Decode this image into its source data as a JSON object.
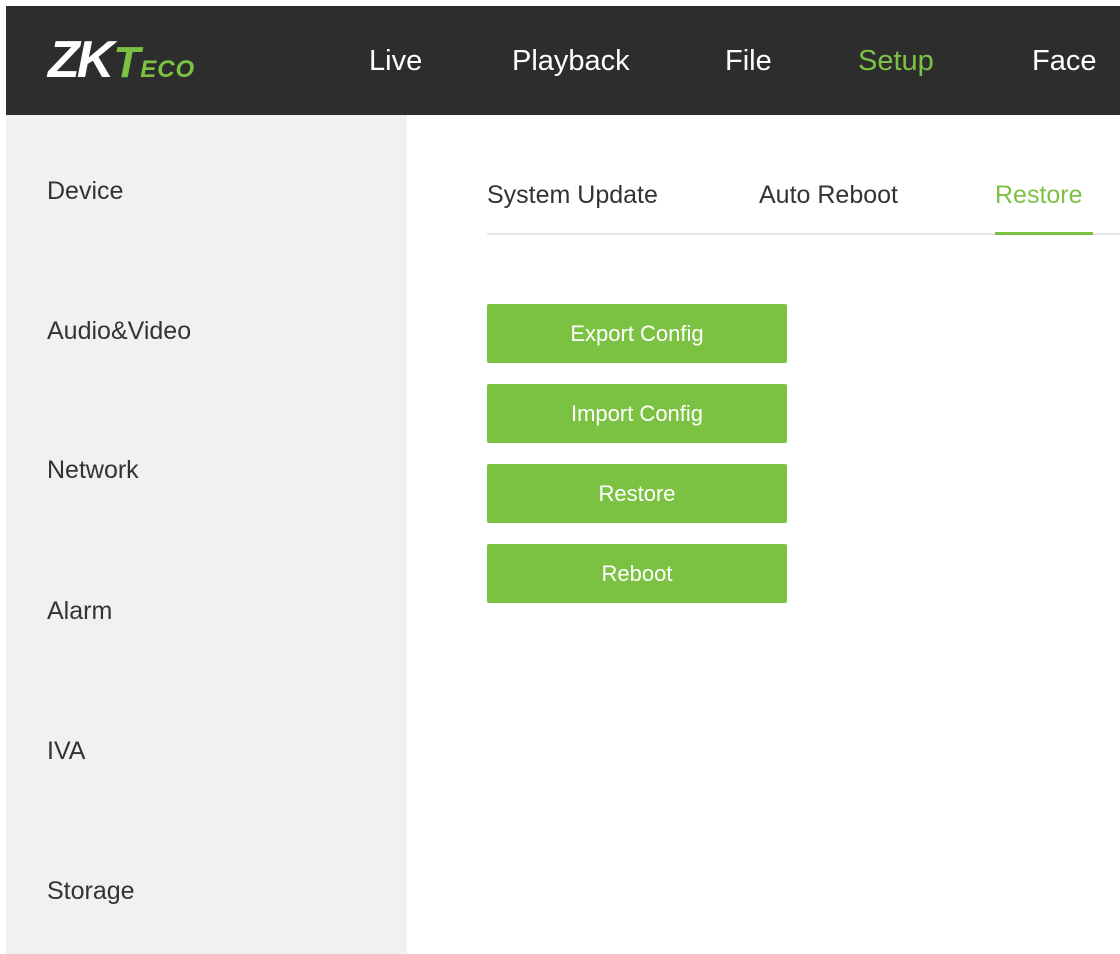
{
  "header": {
    "logo": {
      "zk": "ZK",
      "t": "T",
      "eco": "ECO"
    },
    "nav": [
      "Live",
      "Playback",
      "File",
      "Setup",
      "Face"
    ],
    "active_nav": "Setup"
  },
  "sidebar": {
    "items": [
      "Device",
      "Audio&Video",
      "Network",
      "Alarm",
      "IVA",
      "Storage"
    ]
  },
  "main": {
    "tabs": [
      "System Update",
      "Auto Reboot",
      "Restore"
    ],
    "active_tab": "Restore",
    "buttons": [
      "Export Config",
      "Import Config",
      "Restore",
      "Reboot"
    ]
  },
  "colors": {
    "accent": "#7cc242",
    "header_bg": "#2d2d2d",
    "sidebar_bg": "#f1f1f1"
  }
}
